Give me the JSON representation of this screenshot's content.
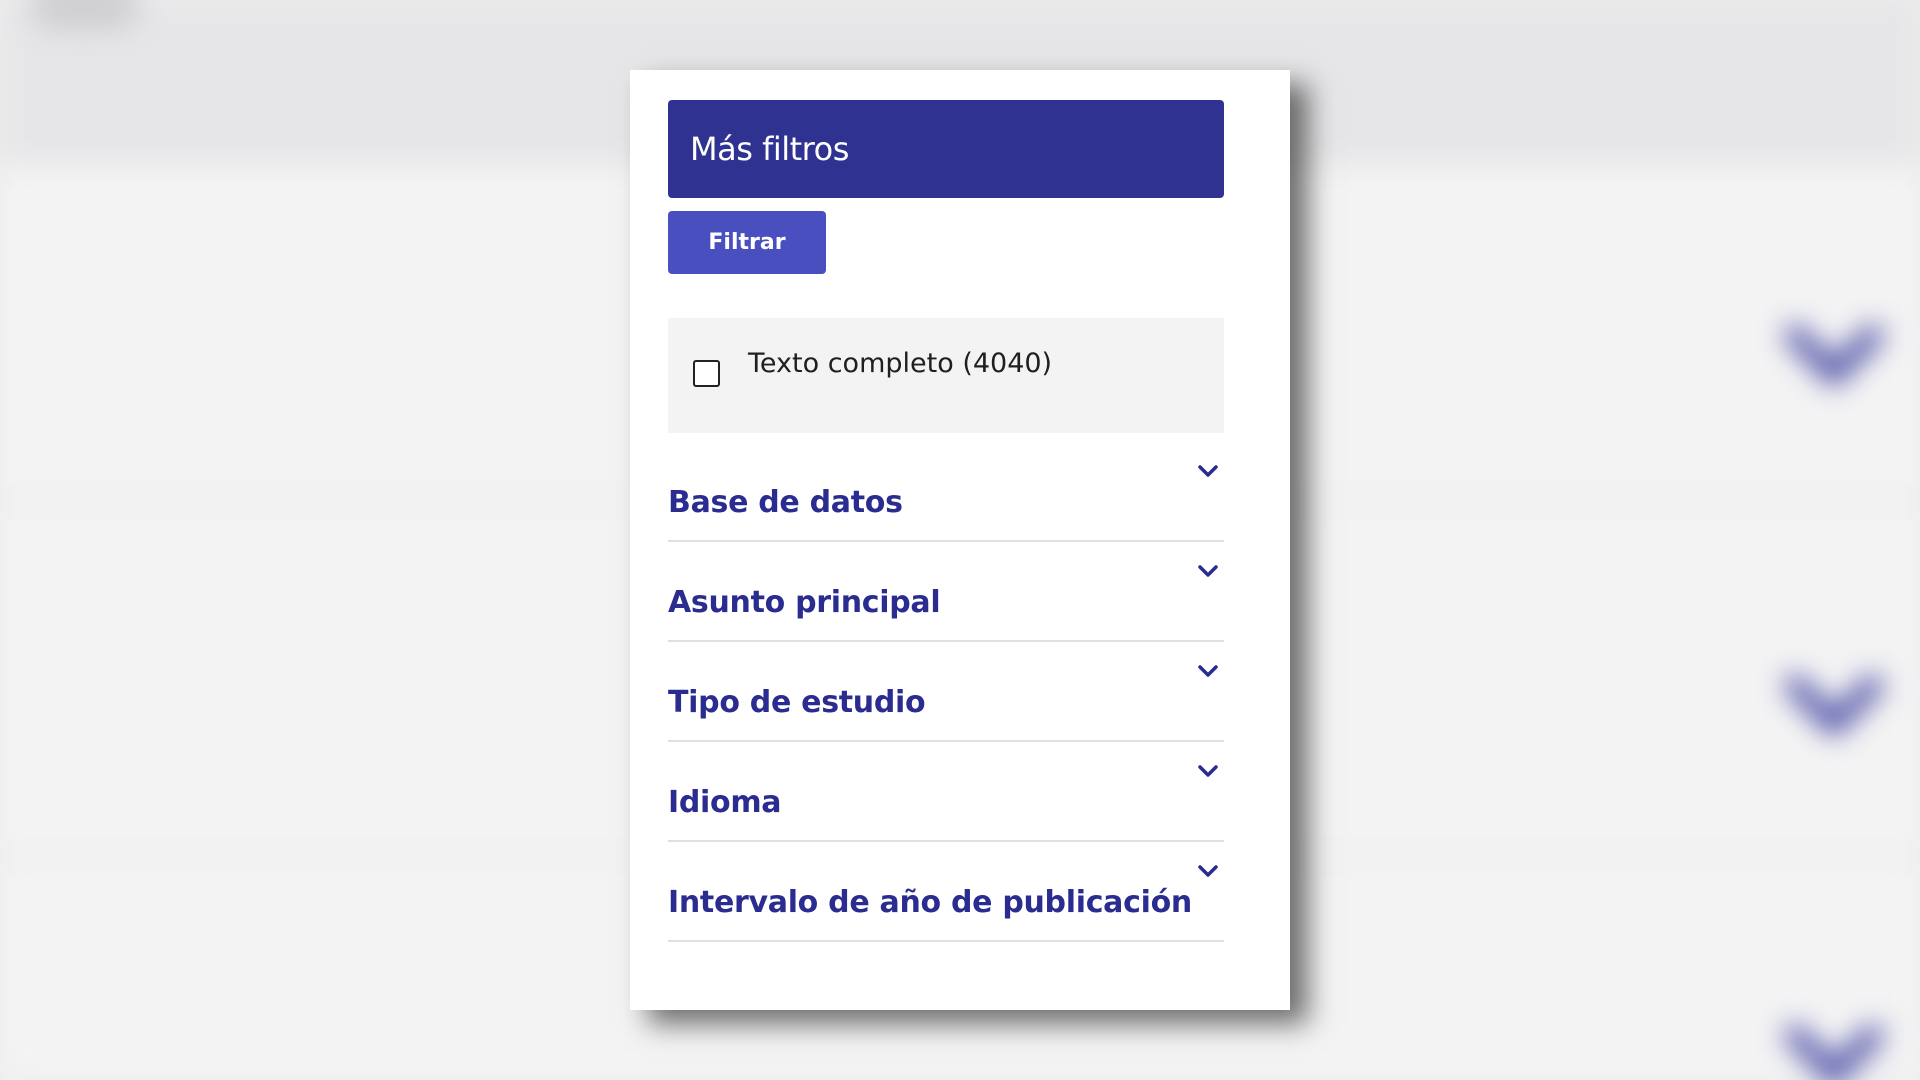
{
  "panel": {
    "title": "Más filtros",
    "filter_button_label": "Filtrar",
    "full_text_label": "Texto completo (4040)",
    "full_text_checked": false
  },
  "facets": [
    {
      "label": "Base de datos",
      "icon": "chevron-down-icon"
    },
    {
      "label": "Asunto principal",
      "icon": "chevron-down-icon"
    },
    {
      "label": "Tipo de estudio",
      "icon": "chevron-down-icon"
    },
    {
      "label": "Idioma",
      "icon": "chevron-down-icon"
    },
    {
      "label": "Intervalo de año de publicación",
      "icon": "chevron-down-icon"
    }
  ],
  "colors": {
    "header_bg": "#2f3290",
    "button_bg": "#4a4fc0",
    "facet_text": "#2a2c90",
    "fulltext_bg": "#f3f3f3"
  }
}
